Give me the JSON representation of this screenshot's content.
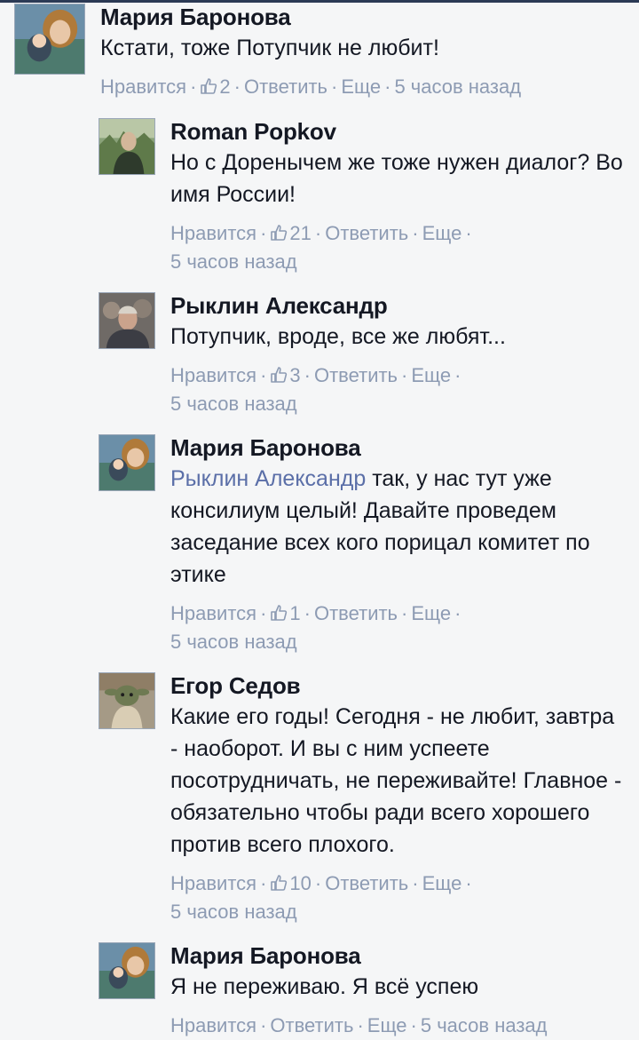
{
  "comments": [
    {
      "author": "Мария Баронова",
      "text": "Кстати, тоже Потупчик не любит!",
      "like_label": "Нравится",
      "likes": "2",
      "reply_label": "Ответить",
      "more_label": "Еще",
      "time": "5 часов назад"
    },
    {
      "author": "Roman Popkov",
      "text": "Но с Доренычем же тоже нужен диалог? Во имя России!",
      "like_label": "Нравится",
      "likes": "21",
      "reply_label": "Ответить",
      "more_label": "Еще",
      "time": "5 часов назад"
    },
    {
      "author": "Рыклин Александр",
      "text": "Потупчик, вроде, все же любят...",
      "like_label": "Нравится",
      "likes": "3",
      "reply_label": "Ответить",
      "more_label": "Еще",
      "time": "5 часов назад"
    },
    {
      "author": "Мария Баронова",
      "mention": "Рыклин Александр",
      "text": "так, у нас тут уже консилиум целый! Давайте проведем заседание всех кого порицал комитет по этике",
      "like_label": "Нравится",
      "likes": "1",
      "reply_label": "Ответить",
      "more_label": "Еще",
      "time": "5 часов назад"
    },
    {
      "author": "Егор Седов",
      "text": "Какие его годы! Сегодня - не любит, завтра - наоборот. И вы с ним успеете посотрудничать, не переживайте! Главное - обязательно чтобы ради всего хорошего против всего плохого.",
      "like_label": "Нравится",
      "likes": "10",
      "reply_label": "Ответить",
      "more_label": "Еще",
      "time": "5 часов назад"
    },
    {
      "author": "Мария Баронова",
      "text": "Я не переживаю. Я всё успею",
      "like_label": "Нравится",
      "reply_label": "Ответить",
      "more_label": "Еще",
      "time": "5 часов назад"
    }
  ],
  "colors": {
    "background": "#f5f6f7",
    "name": "#141823",
    "meta": "#8d9bb3",
    "mention": "#5b6fa8"
  },
  "icons": {
    "like": "thumbs-up-icon"
  }
}
